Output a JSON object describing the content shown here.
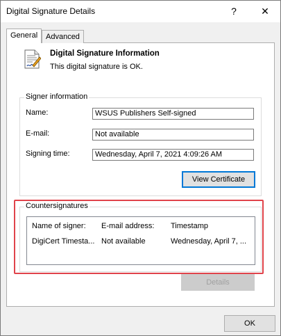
{
  "window": {
    "title": "Digital Signature Details",
    "help_glyph": "?",
    "close_glyph": "✕"
  },
  "tabs": [
    {
      "label": "General",
      "selected": true
    },
    {
      "label": "Advanced",
      "selected": false
    }
  ],
  "info": {
    "title": "Digital Signature Information",
    "status": "This digital signature is OK.",
    "icon": "certificate-document-icon"
  },
  "signer": {
    "group_label": "Signer information",
    "name_label": "Name:",
    "name_value": "WSUS Publishers Self-signed",
    "email_label": "E-mail:",
    "email_value": "Not available",
    "time_label": "Signing time:",
    "time_value": "Wednesday, April 7, 2021 4:09:26 AM",
    "view_cert_label": "View Certificate"
  },
  "countersignatures": {
    "group_label": "Countersignatures",
    "columns": [
      "Name of signer:",
      "E-mail address:",
      "Timestamp"
    ],
    "rows": [
      [
        "DigiCert Timesta...",
        "Not available",
        "Wednesday, April 7, ..."
      ]
    ],
    "details_label": "Details"
  },
  "footer": {
    "ok_label": "OK"
  },
  "colors": {
    "highlight": "#e0434a",
    "focus": "#0078d7"
  }
}
